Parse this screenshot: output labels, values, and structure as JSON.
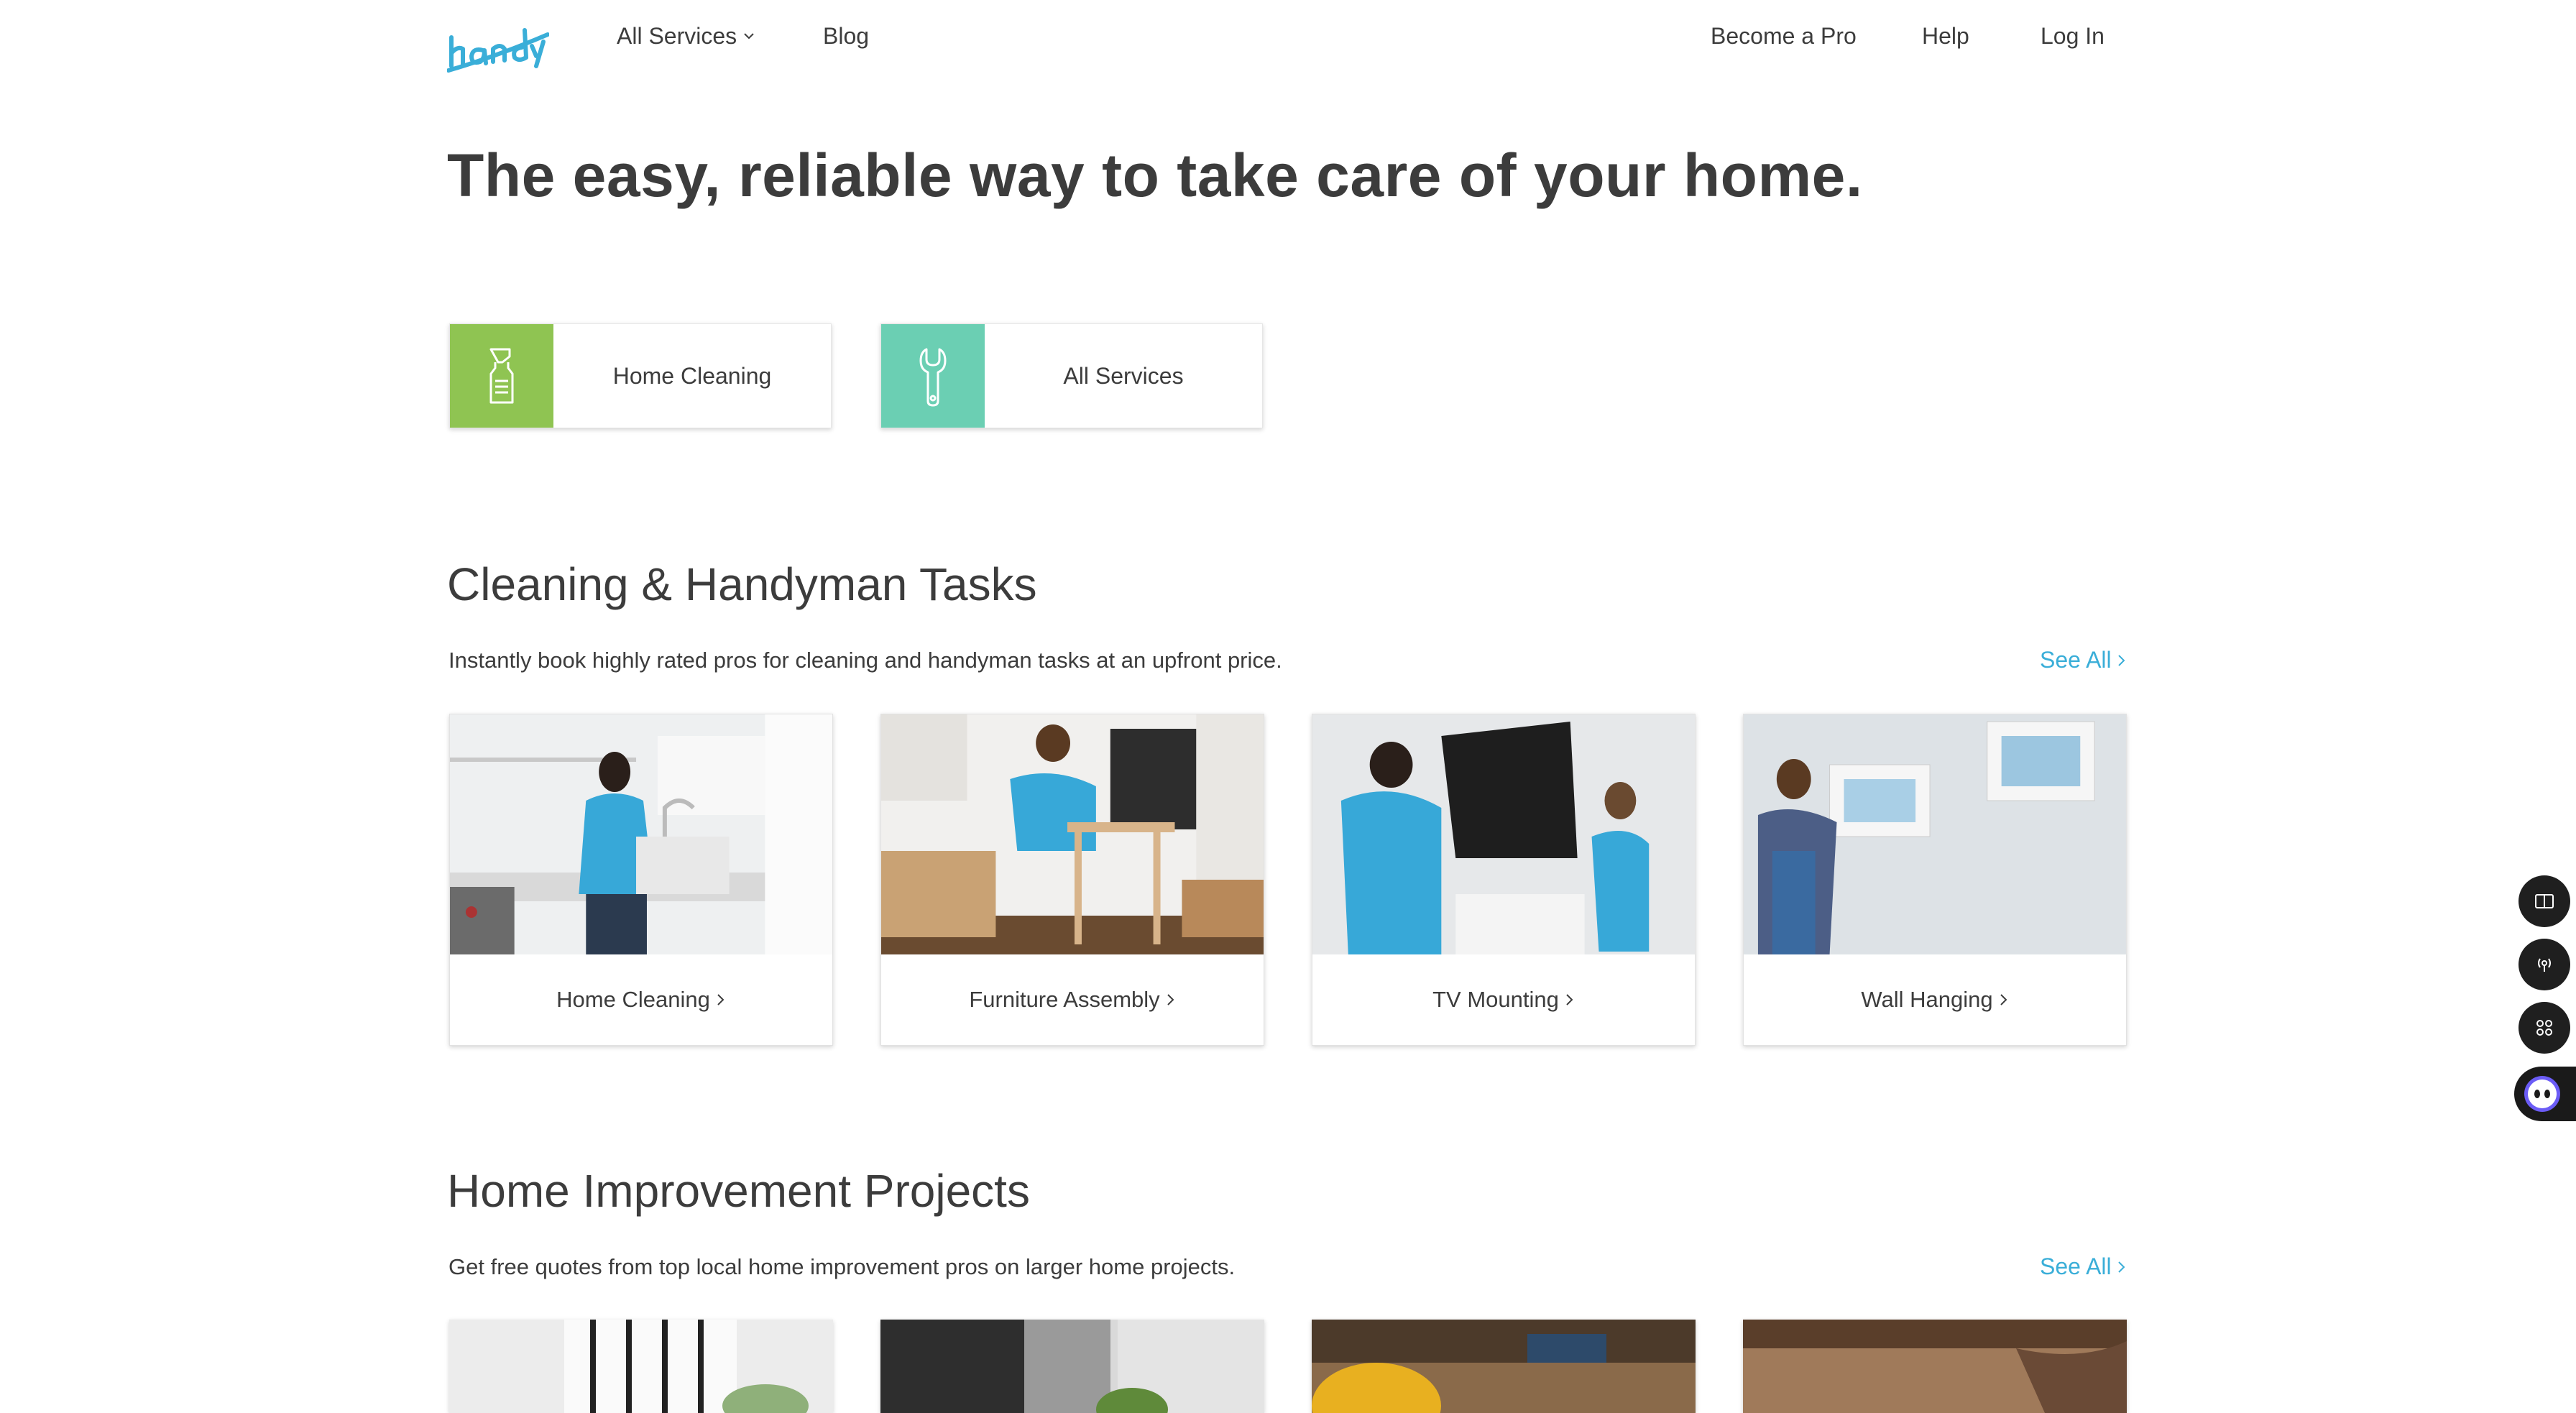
{
  "header": {
    "logo_icon": "handy-logo",
    "nav_left": [
      "All Services",
      "Blog"
    ],
    "nav_right": [
      "Become a Pro",
      "Help",
      "Log In"
    ]
  },
  "hero": {
    "title": "The easy, reliable way to take care of your home."
  },
  "quick_services": [
    {
      "label": "Home Cleaning",
      "icon": "spray-bottle-icon",
      "color": "#8fc452"
    },
    {
      "label": "All Services",
      "icon": "wrench-icon",
      "color": "#6bcfb3"
    }
  ],
  "tasks": {
    "title": "Cleaning & Handyman Tasks",
    "description": "Instantly book highly rated pros for cleaning and handyman tasks at an upfront price.",
    "see_all": "See All",
    "cards": [
      {
        "label": "Home Cleaning"
      },
      {
        "label": "Furniture Assembly"
      },
      {
        "label": "TV Mounting"
      },
      {
        "label": "Wall Hanging"
      }
    ]
  },
  "projects": {
    "title": "Home Improvement Projects",
    "description": "Get free quotes from top local home improvement pros on larger home projects.",
    "see_all": "See All"
  },
  "colors": {
    "accent": "#3aaed8",
    "brand": "#3aaed8",
    "text": "#3c3c3c"
  }
}
